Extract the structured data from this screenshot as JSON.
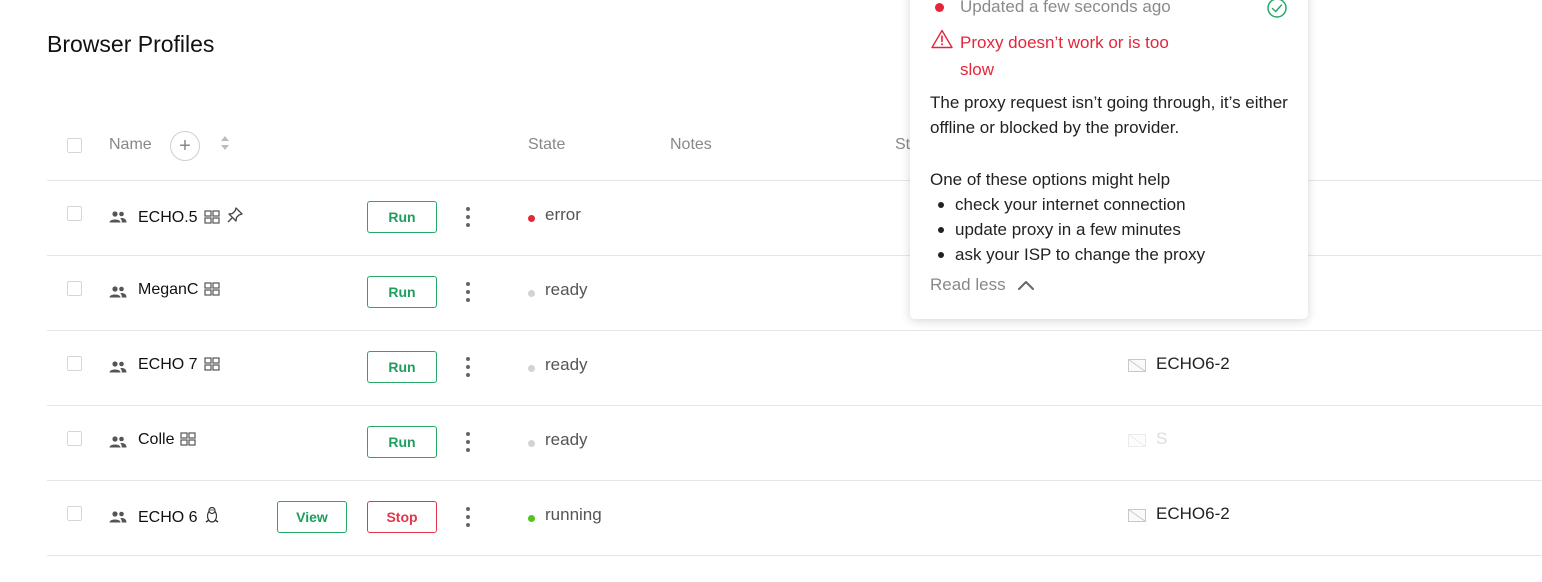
{
  "page": {
    "title": "Browser Profiles"
  },
  "table": {
    "columns": {
      "name": "Name",
      "state": "State",
      "notes": "Notes",
      "status_partial": "St"
    },
    "rows": [
      {
        "name": "ECHO.5",
        "os": "windows",
        "pinned": true,
        "buttons": [
          "Run"
        ],
        "state": "error",
        "state_color": "#e5253a",
        "proxy": ""
      },
      {
        "name": "MeganC",
        "os": "windows",
        "pinned": false,
        "buttons": [
          "Run"
        ],
        "state": "ready",
        "state_color": "#d3d3d3",
        "proxy": ""
      },
      {
        "name": "ECHO 7",
        "os": "windows",
        "pinned": false,
        "buttons": [
          "Run"
        ],
        "state": "ready",
        "state_color": "#d3d3d3",
        "proxy": "ECHO6-2"
      },
      {
        "name": "Colle",
        "os": "windows",
        "pinned": false,
        "buttons": [
          "Run"
        ],
        "state": "ready",
        "state_color": "#d3d3d3",
        "proxy": "S"
      },
      {
        "name": "ECHO 6",
        "os": "linux",
        "pinned": false,
        "buttons": [
          "View",
          "Stop"
        ],
        "state": "running",
        "state_color": "#52c41a",
        "proxy": "ECHO6-2"
      }
    ]
  },
  "popover": {
    "updated": "Updated a few seconds ago",
    "warning": "Proxy doesn’t work or is too slow",
    "body": "The proxy request isn’t going through, it’s either offline or blocked by the provider.",
    "help_intro": "One of these options might help",
    "options": [
      "check your internet connection",
      "update proxy in a few minutes",
      "ask your ISP to change the proxy"
    ],
    "read_less": "Read less"
  },
  "colors": {
    "accent_green": "#1e9e5e",
    "danger_red": "#e5253a",
    "running_green": "#52c41a",
    "muted": "#888888"
  }
}
